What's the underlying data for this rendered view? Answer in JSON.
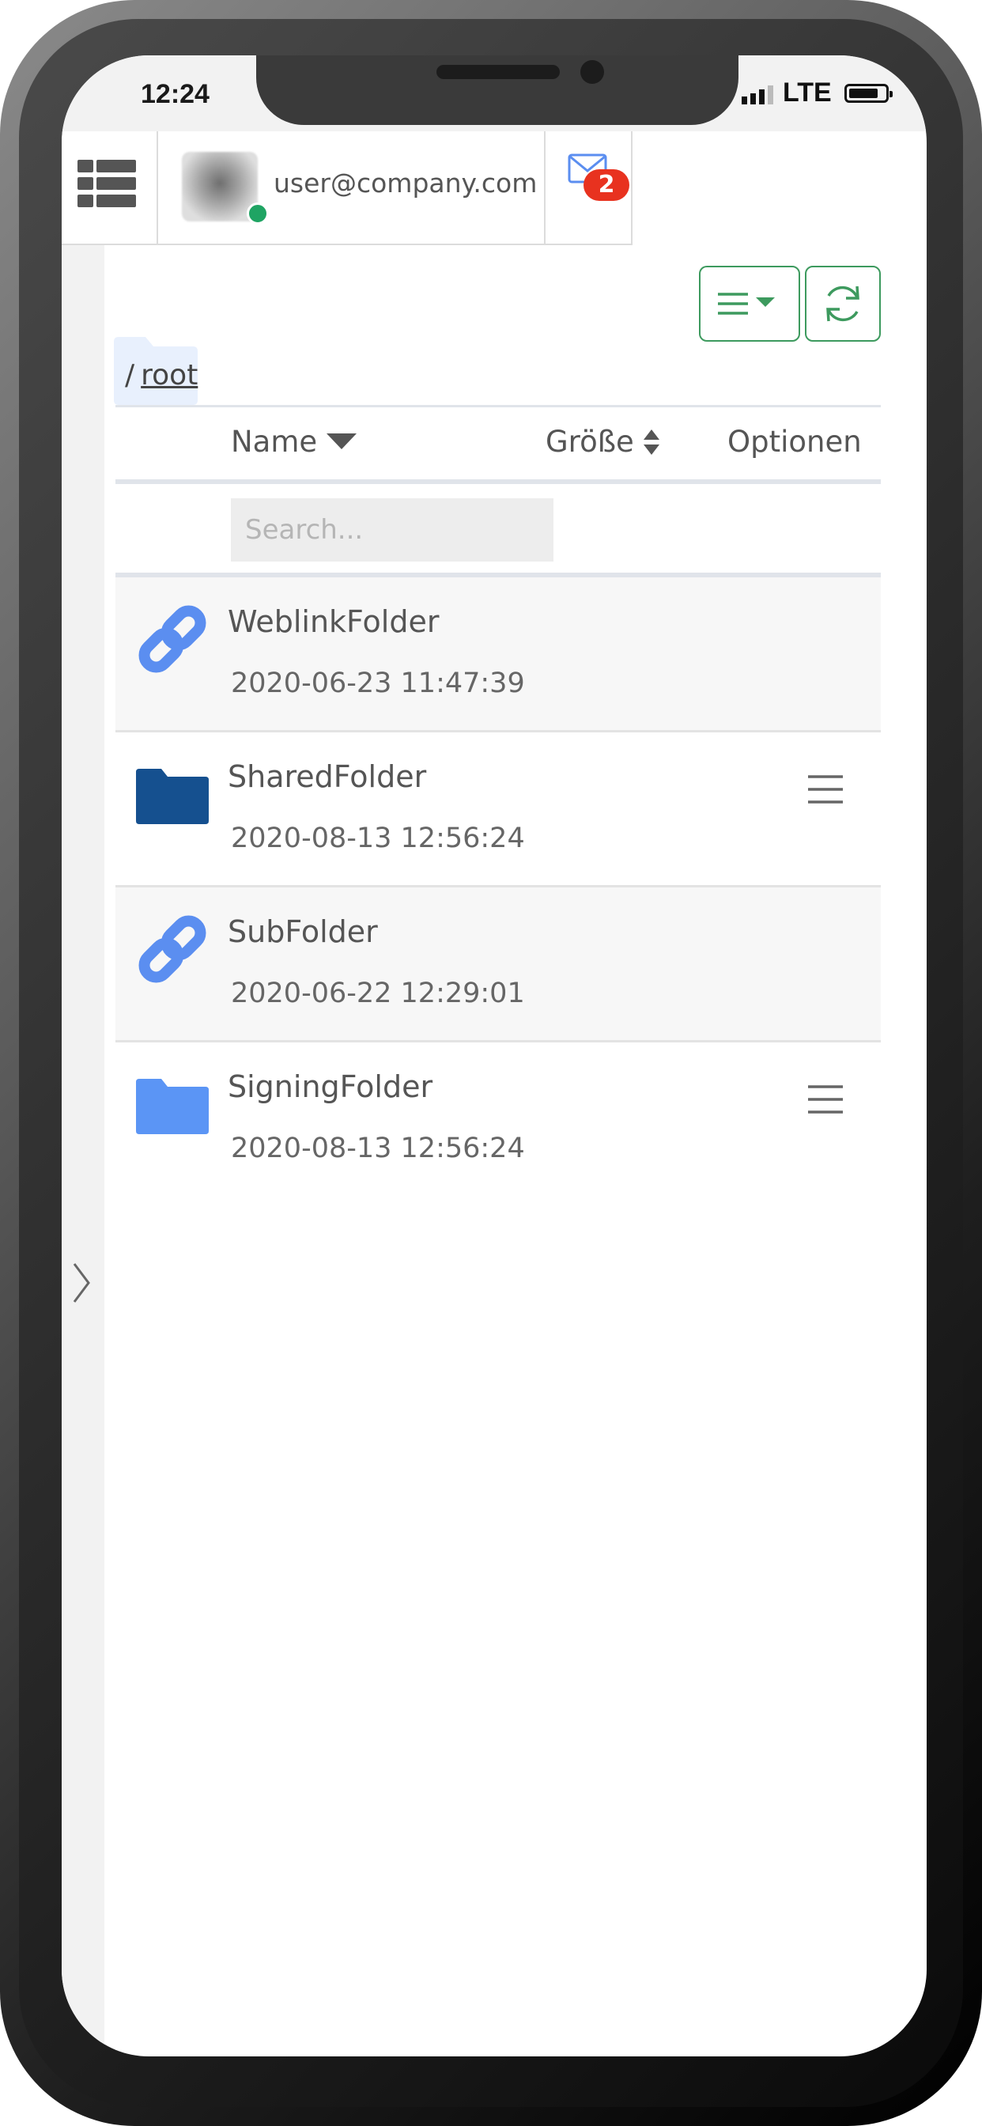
{
  "status_bar": {
    "time": "12:24",
    "network": "LTE"
  },
  "top_bar": {
    "user_email": "user@company.com",
    "mail_badge_count": "2"
  },
  "breadcrumb": {
    "separator": "/",
    "current": "root"
  },
  "table": {
    "columns": {
      "name": "Name",
      "size": "Größe",
      "options": "Optionen"
    },
    "search_placeholder": "Search...",
    "rows": [
      {
        "type": "weblink",
        "name": "WeblinkFolder",
        "date": "2020-06-23 11:47:39",
        "has_menu": false
      },
      {
        "type": "shared-folder",
        "name": "SharedFolder",
        "date": "2020-08-13 12:56:24",
        "has_menu": true
      },
      {
        "type": "weblink",
        "name": "SubFolder",
        "date": "2020-06-22 12:29:01",
        "has_menu": false
      },
      {
        "type": "signing-folder",
        "name": "SigningFolder",
        "date": "2020-08-13 12:56:24",
        "has_menu": true
      }
    ]
  },
  "colors": {
    "accent_green": "#3d9a5e",
    "link_blue": "#5b8ef0",
    "folder_dark_blue": "#15508f",
    "folder_light_blue": "#5b95f5",
    "badge_red": "#e8321f",
    "online_green": "#1fa463"
  },
  "icons": {
    "menu": "grid-list-icon",
    "mail": "envelope-icon",
    "view_toggle": "list-dropdown-icon",
    "refresh": "refresh-icon",
    "sidebar_toggle": "chevron-right-icon"
  }
}
